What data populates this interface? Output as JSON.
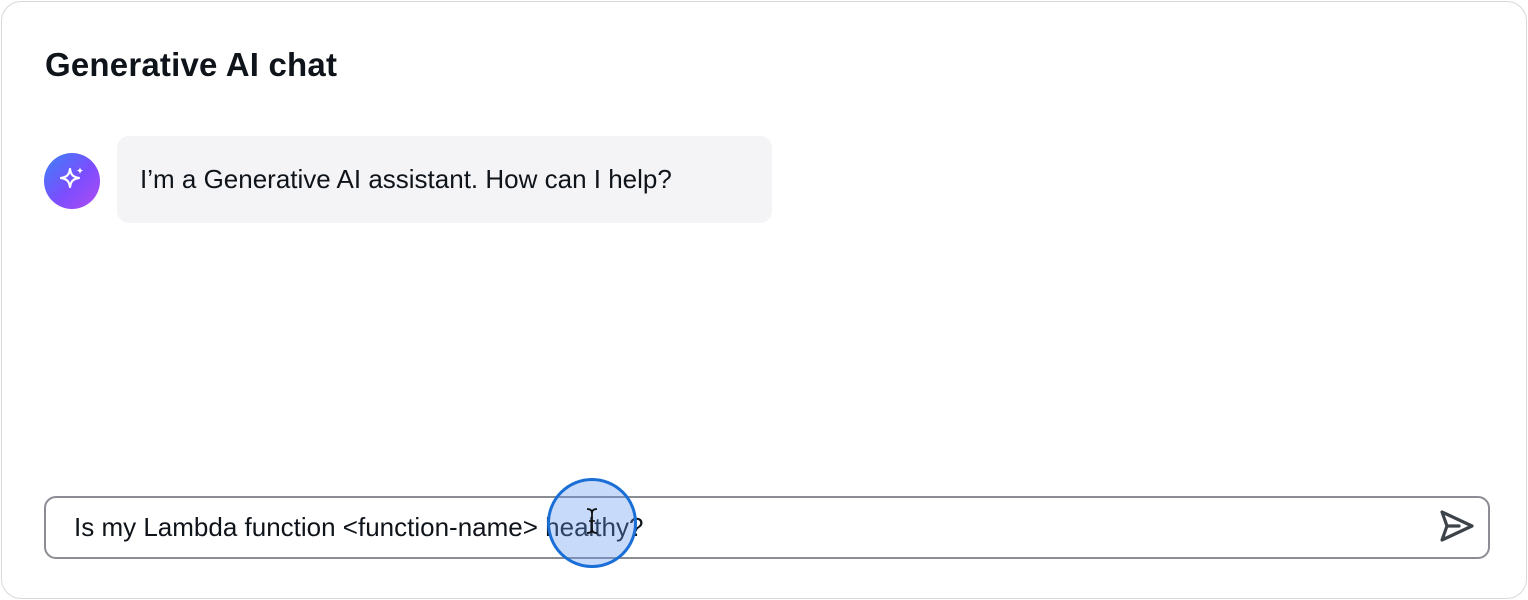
{
  "header": {
    "title": "Generative AI chat"
  },
  "messages": [
    {
      "role": "assistant",
      "avatar_icon": "sparkle-icon",
      "text": "I’m a Generative AI assistant. How can I help?"
    }
  ],
  "prompt_input": {
    "value": "Is my Lambda function <function-name> healthy?",
    "send_icon": "send-icon"
  },
  "colors": {
    "avatar_gradient": [
      "#3b82f6",
      "#7c4dff",
      "#b14cf0"
    ],
    "bubble_bg": "#f4f4f6",
    "input_border": "#8c8c94",
    "cursor_ring": "#1a6fd6"
  }
}
